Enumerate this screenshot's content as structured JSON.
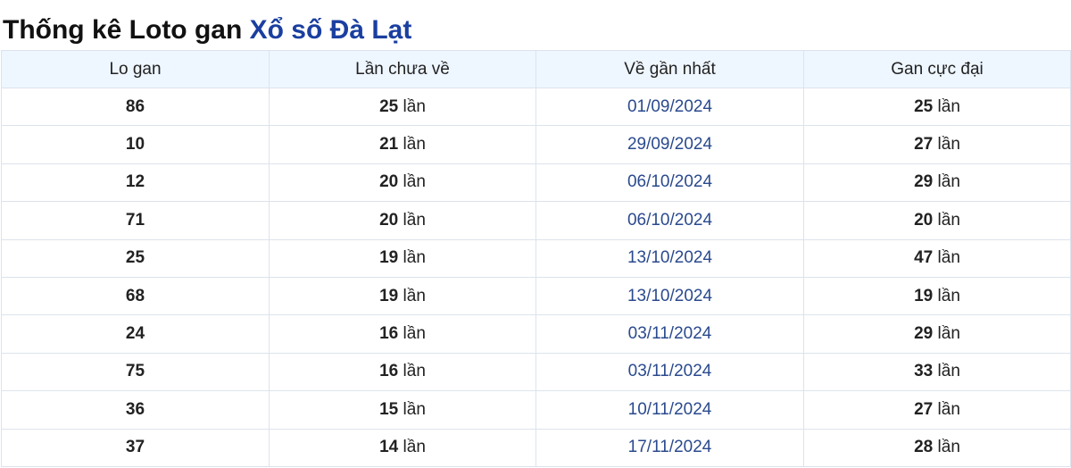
{
  "title": {
    "prefix": "Thống kê Loto gan ",
    "link": "Xổ số Đà Lạt"
  },
  "table": {
    "headers": [
      "Lo gan",
      "Lần chưa về",
      "Về gần nhất",
      "Gan cực đại"
    ],
    "unit": " lần",
    "rows": [
      {
        "number": "86",
        "missed": "25",
        "last_date": "01/09/2024",
        "max_gan": "25"
      },
      {
        "number": "10",
        "missed": "21",
        "last_date": "29/09/2024",
        "max_gan": "27"
      },
      {
        "number": "12",
        "missed": "20",
        "last_date": "06/10/2024",
        "max_gan": "29"
      },
      {
        "number": "71",
        "missed": "20",
        "last_date": "06/10/2024",
        "max_gan": "20"
      },
      {
        "number": "25",
        "missed": "19",
        "last_date": "13/10/2024",
        "max_gan": "47"
      },
      {
        "number": "68",
        "missed": "19",
        "last_date": "13/10/2024",
        "max_gan": "19"
      },
      {
        "number": "24",
        "missed": "16",
        "last_date": "03/11/2024",
        "max_gan": "29"
      },
      {
        "number": "75",
        "missed": "16",
        "last_date": "03/11/2024",
        "max_gan": "33"
      },
      {
        "number": "36",
        "missed": "15",
        "last_date": "10/11/2024",
        "max_gan": "27"
      },
      {
        "number": "37",
        "missed": "14",
        "last_date": "17/11/2024",
        "max_gan": "28"
      }
    ]
  }
}
